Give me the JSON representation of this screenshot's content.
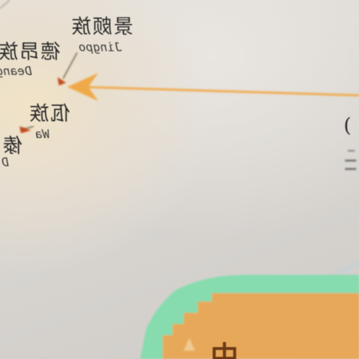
{
  "photo": {
    "subject": "mirrored ethnic-distribution map poster on a wall",
    "colors": {
      "wall": "#d9d6d2",
      "warm_glow": "#f1e3c6",
      "arrow": "#f0a94a",
      "map_green": "#86dcae",
      "map_orange": "#e7a85a"
    },
    "labels": [
      {
        "id": "jingpo",
        "cn": "景颇族",
        "en": "Jingpo"
      },
      {
        "id": "deang",
        "cn": "德昂族",
        "en": "Deang"
      },
      {
        "id": "wa",
        "cn": "佤族",
        "en": "Wa"
      },
      {
        "id": "dai",
        "cn": "傣",
        "en": "D"
      }
    ],
    "map_glyph": "中",
    "edge_glyph": ")"
  }
}
